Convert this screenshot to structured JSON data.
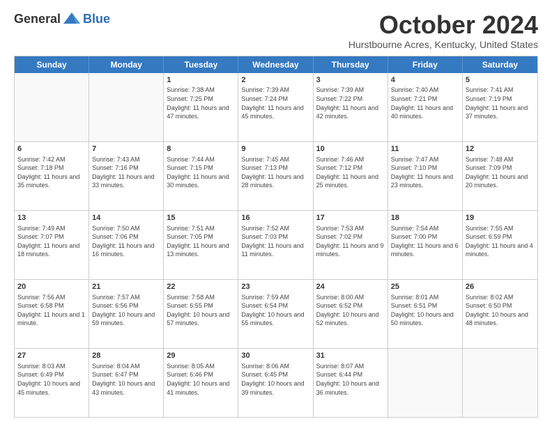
{
  "logo": {
    "general": "General",
    "blue": "Blue"
  },
  "title": "October 2024",
  "location": "Hurstbourne Acres, Kentucky, United States",
  "days": [
    "Sunday",
    "Monday",
    "Tuesday",
    "Wednesday",
    "Thursday",
    "Friday",
    "Saturday"
  ],
  "weeks": [
    [
      {
        "day": "",
        "info": ""
      },
      {
        "day": "",
        "info": ""
      },
      {
        "day": "1",
        "info": "Sunrise: 7:38 AM\nSunset: 7:25 PM\nDaylight: 11 hours and 47 minutes."
      },
      {
        "day": "2",
        "info": "Sunrise: 7:39 AM\nSunset: 7:24 PM\nDaylight: 11 hours and 45 minutes."
      },
      {
        "day": "3",
        "info": "Sunrise: 7:39 AM\nSunset: 7:22 PM\nDaylight: 11 hours and 42 minutes."
      },
      {
        "day": "4",
        "info": "Sunrise: 7:40 AM\nSunset: 7:21 PM\nDaylight: 11 hours and 40 minutes."
      },
      {
        "day": "5",
        "info": "Sunrise: 7:41 AM\nSunset: 7:19 PM\nDaylight: 11 hours and 37 minutes."
      }
    ],
    [
      {
        "day": "6",
        "info": "Sunrise: 7:42 AM\nSunset: 7:18 PM\nDaylight: 11 hours and 35 minutes."
      },
      {
        "day": "7",
        "info": "Sunrise: 7:43 AM\nSunset: 7:16 PM\nDaylight: 11 hours and 33 minutes."
      },
      {
        "day": "8",
        "info": "Sunrise: 7:44 AM\nSunset: 7:15 PM\nDaylight: 11 hours and 30 minutes."
      },
      {
        "day": "9",
        "info": "Sunrise: 7:45 AM\nSunset: 7:13 PM\nDaylight: 11 hours and 28 minutes."
      },
      {
        "day": "10",
        "info": "Sunrise: 7:46 AM\nSunset: 7:12 PM\nDaylight: 11 hours and 25 minutes."
      },
      {
        "day": "11",
        "info": "Sunrise: 7:47 AM\nSunset: 7:10 PM\nDaylight: 11 hours and 23 minutes."
      },
      {
        "day": "12",
        "info": "Sunrise: 7:48 AM\nSunset: 7:09 PM\nDaylight: 11 hours and 20 minutes."
      }
    ],
    [
      {
        "day": "13",
        "info": "Sunrise: 7:49 AM\nSunset: 7:07 PM\nDaylight: 11 hours and 18 minutes."
      },
      {
        "day": "14",
        "info": "Sunrise: 7:50 AM\nSunset: 7:06 PM\nDaylight: 11 hours and 16 minutes."
      },
      {
        "day": "15",
        "info": "Sunrise: 7:51 AM\nSunset: 7:05 PM\nDaylight: 11 hours and 13 minutes."
      },
      {
        "day": "16",
        "info": "Sunrise: 7:52 AM\nSunset: 7:03 PM\nDaylight: 11 hours and 11 minutes."
      },
      {
        "day": "17",
        "info": "Sunrise: 7:53 AM\nSunset: 7:02 PM\nDaylight: 11 hours and 9 minutes."
      },
      {
        "day": "18",
        "info": "Sunrise: 7:54 AM\nSunset: 7:00 PM\nDaylight: 11 hours and 6 minutes."
      },
      {
        "day": "19",
        "info": "Sunrise: 7:55 AM\nSunset: 6:59 PM\nDaylight: 11 hours and 4 minutes."
      }
    ],
    [
      {
        "day": "20",
        "info": "Sunrise: 7:56 AM\nSunset: 6:58 PM\nDaylight: 11 hours and 1 minute."
      },
      {
        "day": "21",
        "info": "Sunrise: 7:57 AM\nSunset: 6:56 PM\nDaylight: 10 hours and 59 minutes."
      },
      {
        "day": "22",
        "info": "Sunrise: 7:58 AM\nSunset: 6:55 PM\nDaylight: 10 hours and 57 minutes."
      },
      {
        "day": "23",
        "info": "Sunrise: 7:59 AM\nSunset: 6:54 PM\nDaylight: 10 hours and 55 minutes."
      },
      {
        "day": "24",
        "info": "Sunrise: 8:00 AM\nSunset: 6:52 PM\nDaylight: 10 hours and 52 minutes."
      },
      {
        "day": "25",
        "info": "Sunrise: 8:01 AM\nSunset: 6:51 PM\nDaylight: 10 hours and 50 minutes."
      },
      {
        "day": "26",
        "info": "Sunrise: 8:02 AM\nSunset: 6:50 PM\nDaylight: 10 hours and 48 minutes."
      }
    ],
    [
      {
        "day": "27",
        "info": "Sunrise: 8:03 AM\nSunset: 6:49 PM\nDaylight: 10 hours and 45 minutes."
      },
      {
        "day": "28",
        "info": "Sunrise: 8:04 AM\nSunset: 6:47 PM\nDaylight: 10 hours and 43 minutes."
      },
      {
        "day": "29",
        "info": "Sunrise: 8:05 AM\nSunset: 6:46 PM\nDaylight: 10 hours and 41 minutes."
      },
      {
        "day": "30",
        "info": "Sunrise: 8:06 AM\nSunset: 6:45 PM\nDaylight: 10 hours and 39 minutes."
      },
      {
        "day": "31",
        "info": "Sunrise: 8:07 AM\nSunset: 6:44 PM\nDaylight: 10 hours and 36 minutes."
      },
      {
        "day": "",
        "info": ""
      },
      {
        "day": "",
        "info": ""
      }
    ]
  ]
}
